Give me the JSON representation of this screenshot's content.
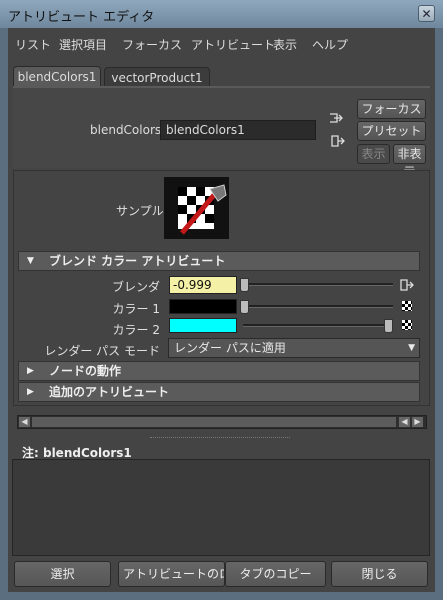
{
  "window": {
    "title": "アトリビュート エディタ",
    "close": "✕"
  },
  "menu": [
    "リスト",
    "選択項目",
    "フォーカス",
    "アトリビュート",
    "表示",
    "ヘルプ"
  ],
  "tabs": [
    {
      "label": "blendColors1",
      "active": true
    },
    {
      "label": "vectorProduct1",
      "active": false
    }
  ],
  "node": {
    "label": "blendColors:",
    "value": "blendColors1"
  },
  "side_buttons": {
    "focus": "フォーカス",
    "preset": "プリセット",
    "show": "表示",
    "hide": "非表示"
  },
  "sample": {
    "label": "サンプル"
  },
  "sections": {
    "blend": {
      "title": "ブレンド カラー アトリビュート",
      "expanded": true
    },
    "node_behavior": {
      "title": "ノードの動作",
      "expanded": false
    },
    "extra": {
      "title": "追加のアトリビュート",
      "expanded": false
    }
  },
  "attrs": {
    "blender": {
      "label": "ブレンダ",
      "value": "-0.999",
      "slider": 0.0
    },
    "color1": {
      "label": "カラー 1",
      "color": "#000000",
      "slider": 0.0
    },
    "color2": {
      "label": "カラー 2",
      "color": "#00ffff",
      "slider": 1.0
    },
    "render_pass": {
      "label": "レンダー パス モード",
      "value": "レンダー パスに適用"
    }
  },
  "notes": {
    "label": "注:  blendColors1"
  },
  "bottom_buttons": [
    "選択",
    "アトリビュートのロード",
    "タブのコピー",
    "閉じる"
  ],
  "colors": {
    "highlight_field": "#f4f0a6",
    "panel": "#444444",
    "header": "#5b5b5b"
  }
}
